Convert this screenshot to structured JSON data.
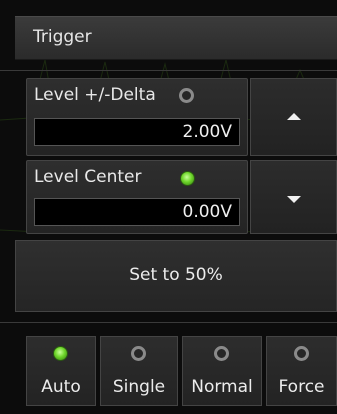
{
  "trigger_panel": {
    "title": "Trigger",
    "level_delta": {
      "label": "Level +/-Delta",
      "value": "2.00V",
      "indicator": "off"
    },
    "level_center": {
      "label": "Level Center",
      "value": "0.00V",
      "indicator": "on"
    },
    "up_arrow_icon": "arrow-up-icon",
    "down_arrow_icon": "arrow-down-icon",
    "set_50_label": "Set to 50%",
    "modes": [
      {
        "label": "Auto",
        "active": true
      },
      {
        "label": "Single",
        "active": false
      },
      {
        "label": "Normal",
        "active": false
      },
      {
        "label": "Force",
        "active": false
      }
    ]
  },
  "colors": {
    "led_on": "#6fd62b",
    "led_off": "#8a8a8a",
    "background": "#0c0c0c"
  }
}
